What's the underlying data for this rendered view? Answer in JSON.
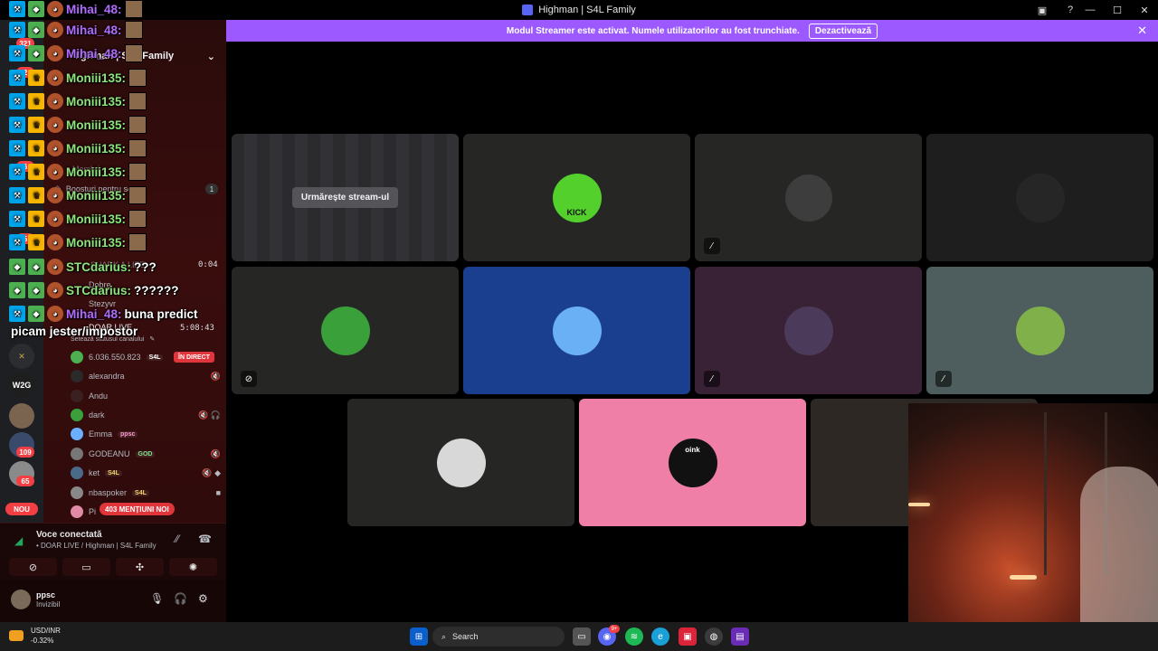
{
  "window": {
    "title": "Highman | S4L Family"
  },
  "banner": {
    "message": "Modul Streamer este activat. Numele utilizatorilor au fost trunchiate.",
    "button_label": "Dezactivează"
  },
  "server_rail": {
    "badges": [
      "321",
      "2",
      "6",
      "5",
      "109",
      "65"
    ],
    "new_label": "NOU",
    "servers": [
      "W2G"
    ]
  },
  "channel_panel": {
    "server_name": "Highman | S4L Family",
    "boost_label": "Boosturi pentru server",
    "boost_count": "1",
    "members_label": "Membri",
    "channels": [
      "SHARK A LIFE",
      "Dobre",
      "Stezyvr",
      "DOAR LIVE"
    ],
    "set_status": "Setează statusul canalului",
    "timers": [
      "0:04",
      "5:08:43"
    ]
  },
  "voice_users": [
    {
      "name": "6.036.550.823",
      "tag": "S4L",
      "live": "ÎN DIRECT"
    },
    {
      "name": "alexandra",
      "tag": "",
      "icons": "🔇"
    },
    {
      "name": "Andu",
      "tag": "",
      "icons": ""
    },
    {
      "name": "dark",
      "tag": "",
      "icons": "🔇 🎧"
    },
    {
      "name": "Emma",
      "tag": "ppsc",
      "icons": ""
    },
    {
      "name": "GODEANU",
      "tag": "GOD",
      "icons": "🔇"
    },
    {
      "name": "ket",
      "tag": "S4L",
      "icons": "🔇 ◆"
    },
    {
      "name": "nbaspoker",
      "tag": "S4L",
      "icons": "■"
    },
    {
      "name": "Pi",
      "tag": "",
      "icons": ""
    }
  ],
  "mentions_label": "403 MENȚIUNI NOI",
  "voice_panel": {
    "status": "Voce conectată",
    "channel_path": "• DOAR LIVE / Highman | S4L Family"
  },
  "user_panel": {
    "name": "ppsc",
    "status": "Invizibil"
  },
  "stage": {
    "watch_label": "Urmărește stream-ul",
    "avatar_labels": [
      "KICK",
      "oink"
    ]
  },
  "chat": [
    {
      "user": "Mihai_48:",
      "color": "#b16cff",
      "text": ""
    },
    {
      "user": "Mihai_48:",
      "color": "#b16cff",
      "text": ""
    },
    {
      "user": "Mihai_48:",
      "color": "#b16cff",
      "text": ""
    },
    {
      "user": "Moniii135:",
      "color": "#8fe37a",
      "text": ""
    },
    {
      "user": "Moniii135:",
      "color": "#8fe37a",
      "text": ""
    },
    {
      "user": "Moniii135:",
      "color": "#8fe37a",
      "text": ""
    },
    {
      "user": "Moniii135:",
      "color": "#8fe37a",
      "text": ""
    },
    {
      "user": "Moniii135:",
      "color": "#8fe37a",
      "text": ""
    },
    {
      "user": "Moniii135:",
      "color": "#8fe37a",
      "text": ""
    },
    {
      "user": "Moniii135:",
      "color": "#8fe37a",
      "text": ""
    },
    {
      "user": "Moniii135:",
      "color": "#8fe37a",
      "text": ""
    },
    {
      "user": "STCdarius:",
      "color": "#8fe37a",
      "text": "???"
    },
    {
      "user": "STCdarius:",
      "color": "#8fe37a",
      "text": "??????"
    },
    {
      "user": "Mihai_48:",
      "color": "#b16cff",
      "text": "buna predict"
    }
  ],
  "chat_wrap": "picam jester/impostor",
  "taskbar": {
    "ticker_name": "USD/INR",
    "ticker_change": "-0.32%",
    "search_placeholder": "Search",
    "discord_badge": "9+"
  },
  "colors": {
    "banner": "#9b59ff",
    "live": "#e0353b",
    "tile_blue": "#1b3f8f",
    "tile_pink": "#ef7fa6"
  }
}
